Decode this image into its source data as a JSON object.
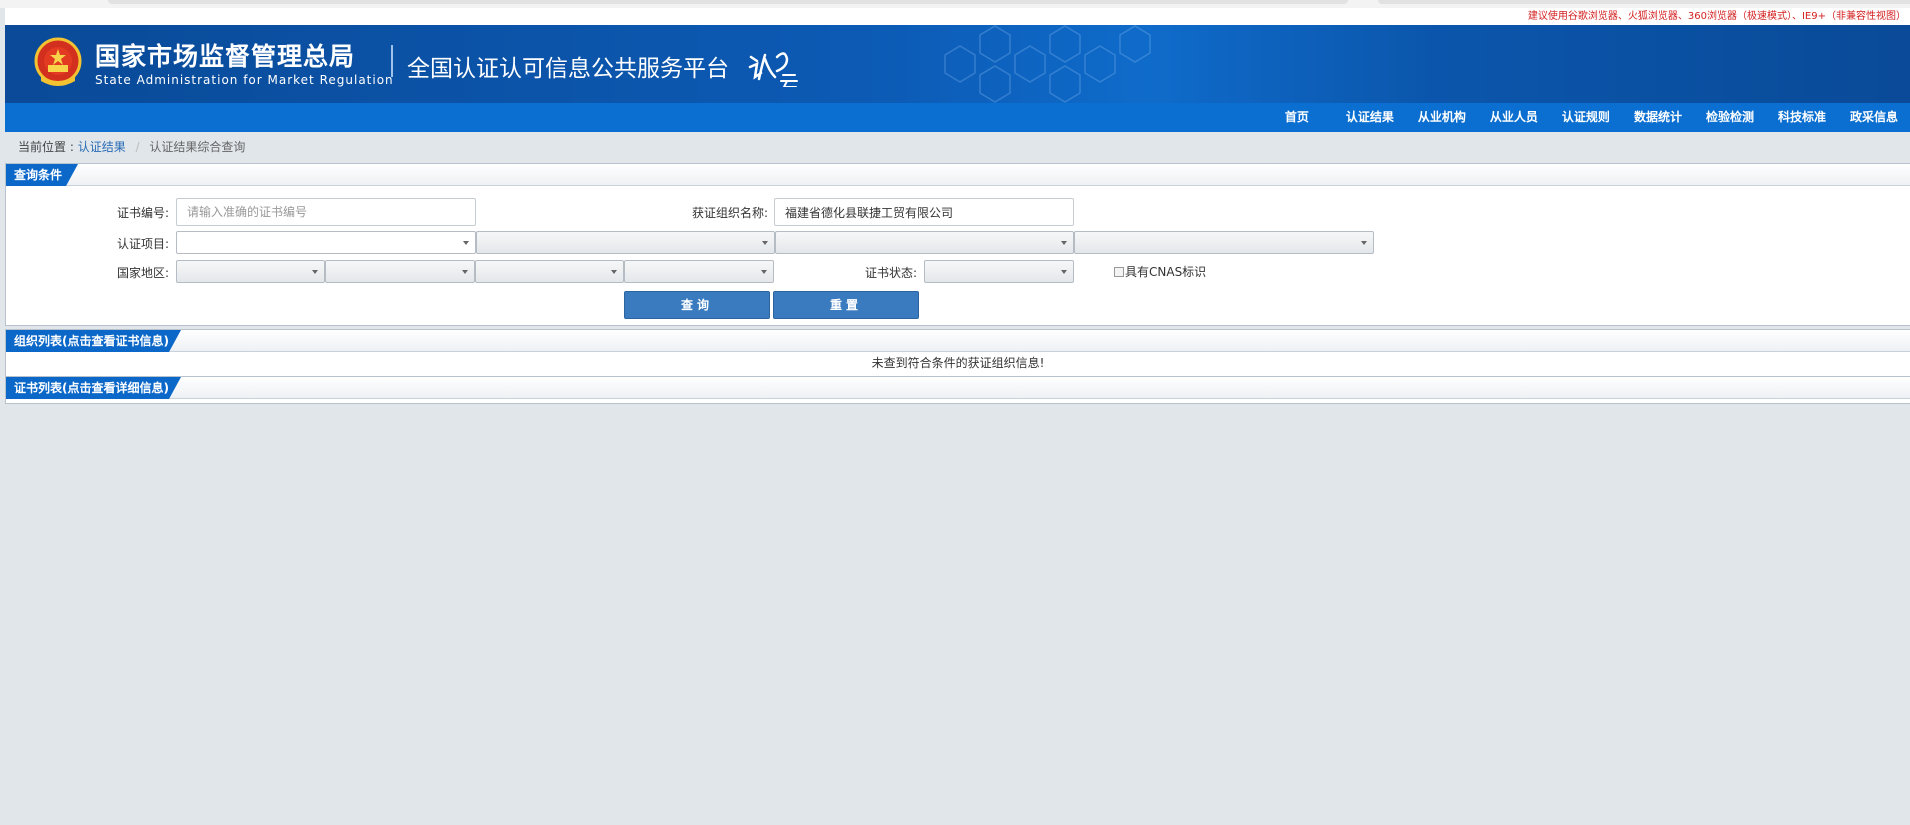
{
  "notice": "建议使用谷歌浏览器、火狐浏览器、360浏览器（极速模式）、IE9+（非兼容性视图）",
  "header": {
    "org_cn": "国家市场监督管理总局",
    "org_en": "State Administration  for  Market Regulation",
    "platform_title": "全国认证认可信息公共服务平台"
  },
  "nav": {
    "items": [
      "首页",
      "认证结果",
      "从业机构",
      "从业人员",
      "认证规则",
      "数据统计",
      "检验检测",
      "科技标准",
      "政采信息"
    ]
  },
  "breadcrumb": {
    "prefix": "当前位置 :",
    "link": "认证结果",
    "separator": "/",
    "current": "认证结果综合查询"
  },
  "query": {
    "title": "查询条件",
    "cert_no_label": "证书编号:",
    "cert_no_placeholder": "请输入准确的证书编号",
    "org_name_label": "获证组织名称:",
    "org_name_value": "福建省德化县联捷工贸有限公司",
    "project_label": "认证项目:",
    "region_label": "国家地区:",
    "status_label": "证书状态:",
    "cnas_label": "具有CNAS标识",
    "search_button": "查询",
    "reset_button": "重置"
  },
  "org_list": {
    "title": "组织列表(点击查看证书信息)",
    "empty_message": "未查到符合条件的获证组织信息!"
  },
  "cert_list": {
    "title": "证书列表(点击查看详细信息)"
  },
  "colors": {
    "header_blue": "#0a4a98",
    "nav_blue": "#0a6fd0",
    "tab_blue": "#0b68c9",
    "button_blue": "#3a7bbf",
    "notice_red": "#d31e1e"
  }
}
